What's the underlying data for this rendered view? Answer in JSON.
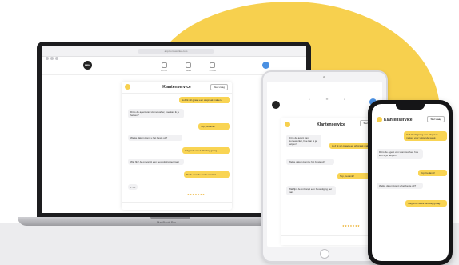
{
  "mac": {
    "url": "app.homeworker.com",
    "logo": "HW",
    "nav": [
      "Home",
      "Chat",
      "Profile"
    ],
    "chat_title": "Klantenservice",
    "chat_button": "Stel vraag",
    "messages": [
      {
        "dir": "out",
        "text": "Hoi! Ik wil graag een afspraak maken."
      },
      {
        "dir": "in",
        "text": "Dit is de agent van Homeworker, hoe kan ik je helpen?"
      },
      {
        "dir": "out",
        "text": "Top, bedankt!"
      },
      {
        "dir": "in",
        "text": "Welke datum komt u het beste uit?"
      },
      {
        "dir": "out",
        "text": "Volgende week dinsdag graag."
      },
      {
        "dir": "in",
        "text": "Wat fijn! Je ontvangt een bevestiging per mail."
      },
      {
        "dir": "out",
        "text": "Dank voor de snelle reactie!"
      }
    ],
    "typing": "• • •",
    "emojis": "★★★★★★★",
    "brand": "MacBook Pro"
  },
  "ipad": {
    "chat_title": "Klantenservice",
    "chat_button": "Stel vraag",
    "messages": [
      {
        "dir": "out",
        "text": "Hoi! Ik wil graag een afspraak maken."
      },
      {
        "dir": "in",
        "text": "Dit is de agent van Homeworker, hoe kan ik je helpen?"
      },
      {
        "dir": "out",
        "text": "Top, bedankt!"
      },
      {
        "dir": "in",
        "text": "Welke datum komt u het beste uit?"
      },
      {
        "dir": "in",
        "text": "Wat fijn! Je ontvangt een bevestiging per mail."
      }
    ]
  },
  "iphone": {
    "chat_title": "Klantenservice",
    "chat_button": "Stel vraag",
    "messages": [
      {
        "dir": "out",
        "text": "Hoi! Ik wil graag een afspraak maken voor volgende week."
      },
      {
        "dir": "in",
        "text": "Dit is de agent van Homeworker, hoe kan ik je helpen?"
      },
      {
        "dir": "out",
        "text": "Top, bedankt!"
      },
      {
        "dir": "in",
        "text": "Welke datum komt u het beste uit?"
      },
      {
        "dir": "out",
        "text": "Volgende week dinsdag graag."
      }
    ]
  },
  "colors": {
    "accent": "#f7d04e",
    "bubble_out": "#f9d453",
    "bubble_in": "#f1f1f3",
    "avatar": "#4a90e2"
  }
}
